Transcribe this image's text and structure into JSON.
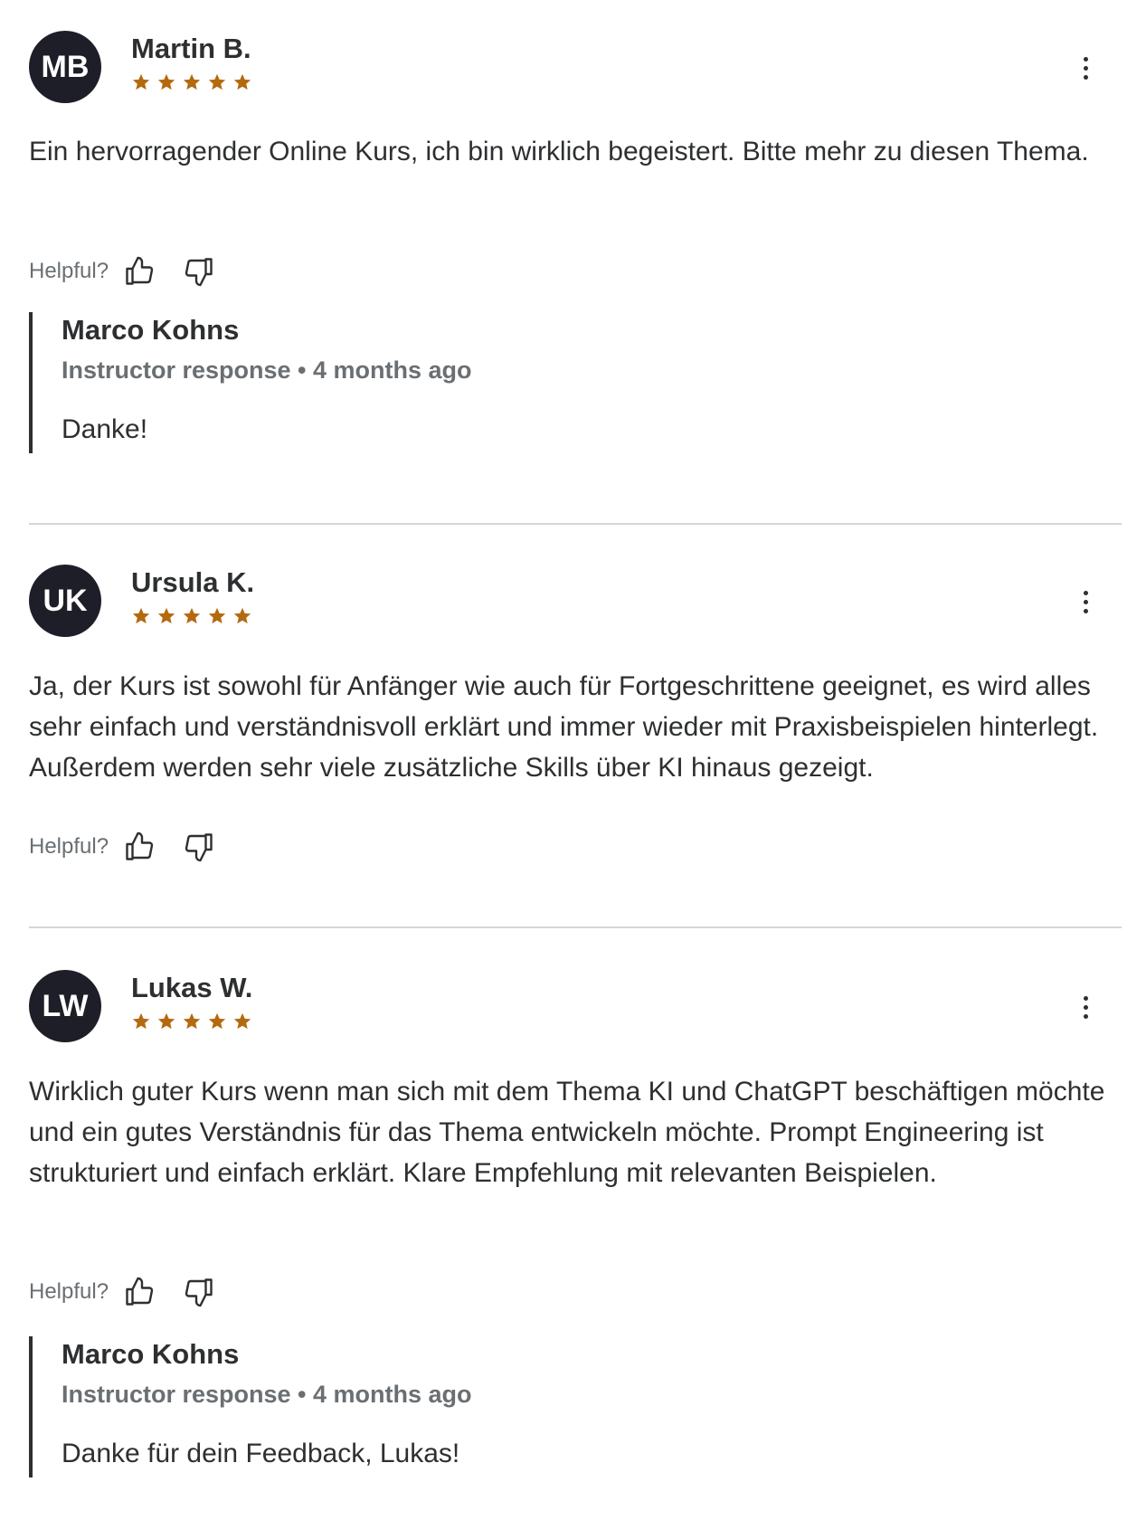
{
  "reviews": [
    {
      "initials": "MB",
      "name": "Martin B.",
      "rating": 5,
      "text": "Ein hervorragender Online Kurs, ich bin wirklich begeistert. Bitte mehr zu diesen Thema.",
      "helpful_label": "Helpful?",
      "response": {
        "name": "Marco Kohns",
        "meta": "Instructor response • 4 months ago",
        "text": "Danke!"
      }
    },
    {
      "initials": "UK",
      "name": "Ursula K.",
      "rating": 5,
      "text": "Ja, der Kurs ist sowohl für Anfänger wie auch für Fortgeschrittene geeignet, es wird alles sehr einfach und verständnisvoll erklärt und immer wieder mit Praxisbeispielen hinterlegt. Außerdem werden sehr viele zusätzliche Skills über KI hinaus gezeigt.",
      "helpful_label": "Helpful?"
    },
    {
      "initials": "LW",
      "name": "Lukas W.",
      "rating": 5,
      "text": "Wirklich guter Kurs wenn man sich mit dem Thema KI und ChatGPT beschäftigen möchte und ein gutes Verständnis für das Thema entwickeln möchte. Prompt Engineering ist strukturiert und einfach erklärt. Klare Empfehlung mit relevanten Beispielen.",
      "helpful_label": "Helpful?",
      "response": {
        "name": "Marco Kohns",
        "meta": "Instructor response • 4 months ago",
        "text": "Danke für dein Feedback, Lukas!"
      }
    }
  ],
  "colors": {
    "star": "#b4690e",
    "avatar_bg": "#1d1e27",
    "text": "#2d2f31",
    "muted": "#6a6f73",
    "divider": "#d1d7dc"
  },
  "icons": {
    "more": "more-vertical-icon",
    "like": "thumbs-up-icon",
    "dislike": "thumbs-down-icon",
    "star": "star-icon"
  }
}
